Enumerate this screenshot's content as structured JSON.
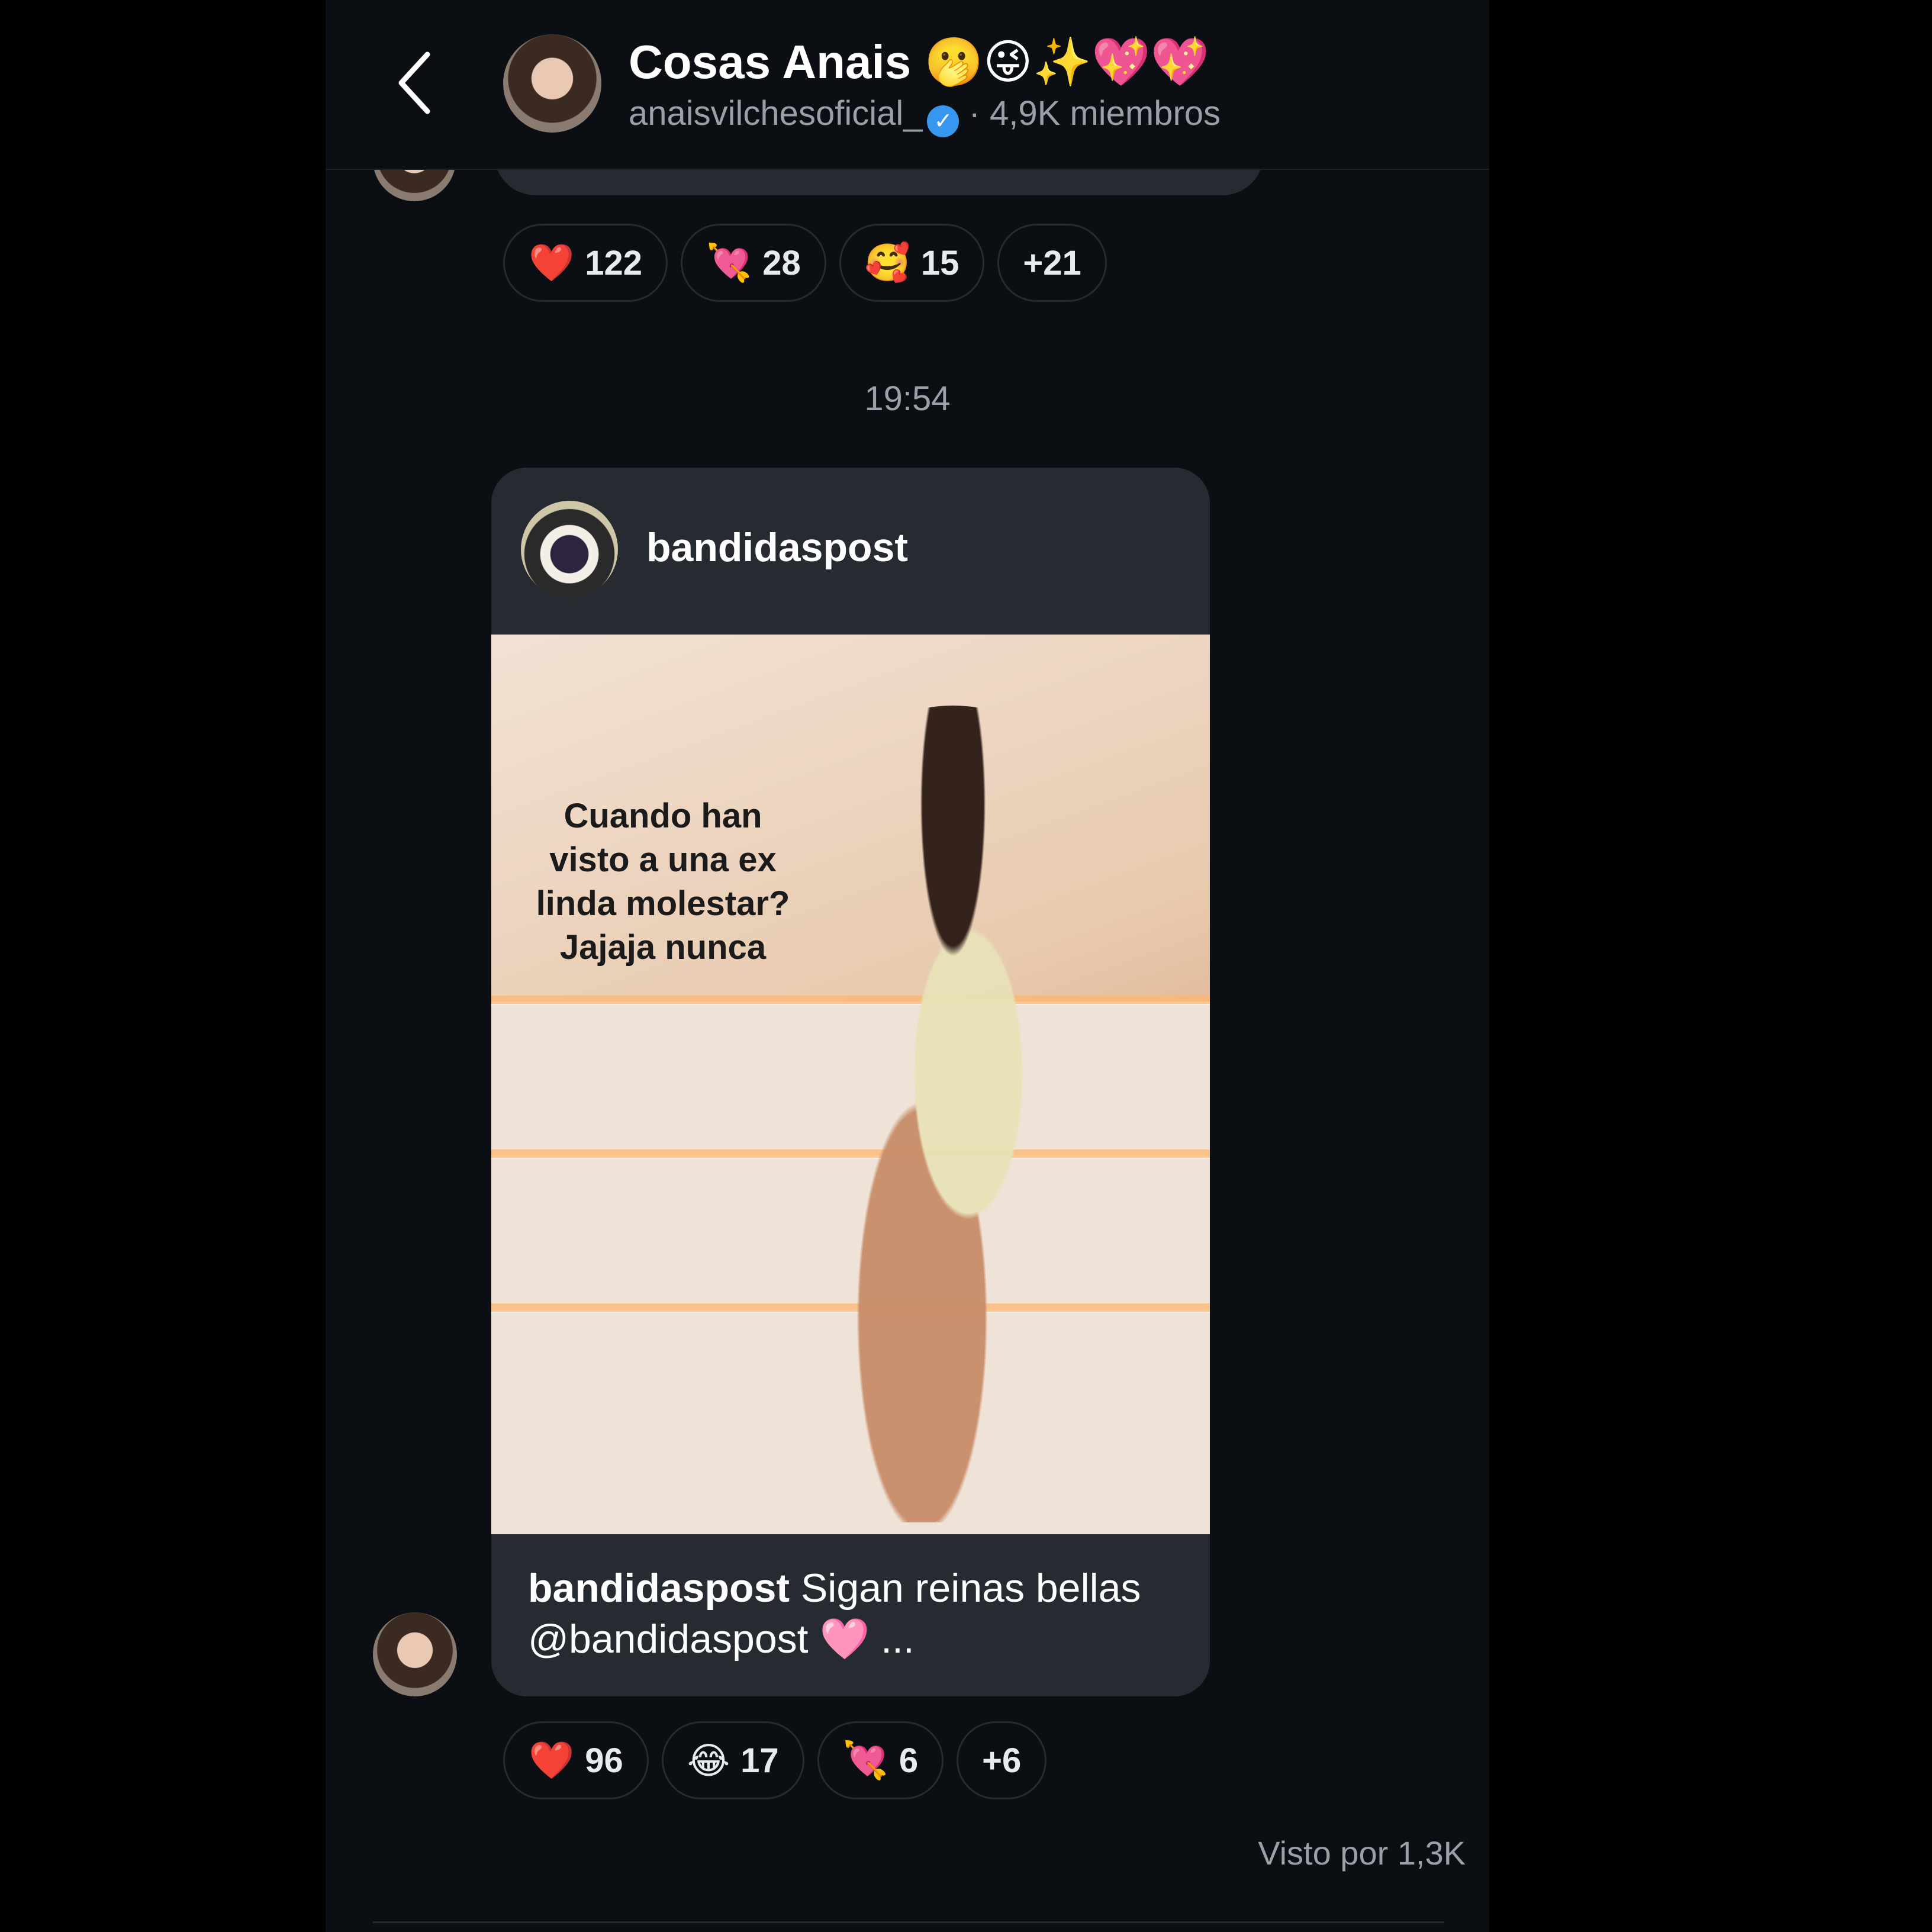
{
  "header": {
    "back_label": "‹",
    "title": "Cosas Anais 🫢😜✨💖💖",
    "username": "anaisvilchesoficial_",
    "verified_mark": "✓",
    "members": "· 4,9K miembros"
  },
  "top_reactions": [
    {
      "emoji": "❤️",
      "count": "122"
    },
    {
      "emoji": "💘",
      "count": "28"
    },
    {
      "emoji": "🥰",
      "count": "15"
    },
    {
      "emoji": "",
      "count": "+21"
    }
  ],
  "timestamp": "19:54",
  "post": {
    "author": "bandidaspost",
    "image_text": "Cuando han visto a una ex linda molestar? Jajaja nunca",
    "caption_author": "bandidaspost",
    "caption_text": "Sigan reinas bellas @bandidaspost",
    "caption_heart": "🩷",
    "caption_more": "..."
  },
  "bottom_reactions": [
    {
      "emoji": "❤️",
      "count": "96"
    },
    {
      "emoji": "😂",
      "count": "17"
    },
    {
      "emoji": "💘",
      "count": "6"
    },
    {
      "emoji": "",
      "count": "+6"
    }
  ],
  "seen_by": "Visto por 1,3K",
  "colors": {
    "background": "#0b0e13",
    "bubble": "#262a31",
    "text_primary": "#ffffff",
    "text_secondary": "#9aa0a8",
    "verified": "#3797f0"
  }
}
